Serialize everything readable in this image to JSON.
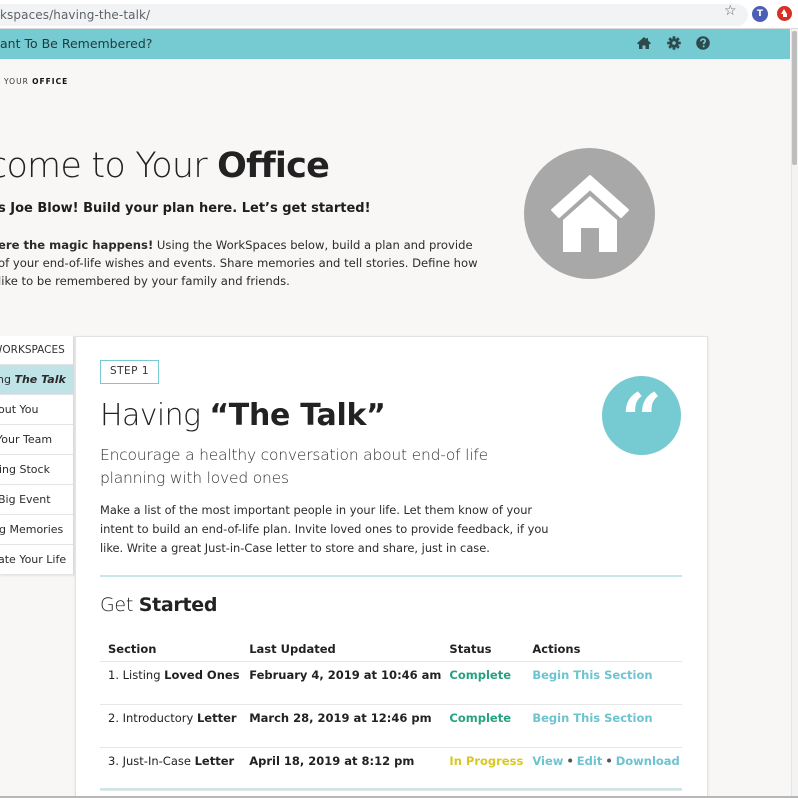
{
  "browser": {
    "url": "kspaces/having-the-talk/",
    "profile_initial": "T"
  },
  "appbar": {
    "title": "ant To Be Remembered?",
    "icons": [
      "home-icon",
      "gear-icon",
      "help-icon"
    ]
  },
  "breadcrumb": {
    "prefix": "YOUR",
    "current": "OFFICE"
  },
  "welcome": {
    "title_light": "come to Your ",
    "title_bold": "Office",
    "subtitle": "s Joe Blow! Build your plan here. Let’s get started!",
    "body_bold": "ere the magic happens!",
    "body_lines": [
      " Using the WorkSpaces below, build a plan and provide",
      " of your end-of-life wishes and events. Share memories and tell stories. Define how",
      "like to be remembered by your family and friends."
    ]
  },
  "sidebar": {
    "header": "WORKSPACES",
    "items": [
      {
        "prefix": "ng ",
        "italic": "The Talk",
        "active": true
      },
      {
        "label": "out You",
        "active": false
      },
      {
        "label": " Your Team",
        "active": false
      },
      {
        "label": "ing Stock",
        "active": false
      },
      {
        "label": " Big Event",
        "active": false
      },
      {
        "label": "g Memories",
        "active": false
      },
      {
        "label": "ate Your Life",
        "active": false
      }
    ]
  },
  "step": {
    "badge": "STEP 1",
    "title_light": "Having ",
    "title_bold": "“The Talk”",
    "subtitle": "Encourage a healthy conversation about end-of life planning with loved ones",
    "description_lines": [
      "Make a list of the most important people in your life. Let them know of your",
      "intent to build an end-of-life plan. Invite loved ones to provide feedback, if you",
      "like. Write a great Just-in-Case letter to store and share, just in case."
    ],
    "quote_glyph": "“"
  },
  "get_started": {
    "title_light": "Get ",
    "title_bold": "Started",
    "columns": [
      "Section",
      "Last Updated",
      "Status",
      "Actions"
    ],
    "rows": [
      {
        "section_prefix": "1. Listing ",
        "section_bold": "Loved Ones",
        "updated": "February 4, 2019 at 10:46 am",
        "status": "Complete",
        "status_type": "complete",
        "actions": [
          "Begin This Section"
        ]
      },
      {
        "section_prefix": "2. Introductory ",
        "section_bold": "Letter",
        "updated": "March 28, 2019 at 12:46 pm",
        "status": "Complete",
        "status_type": "complete",
        "actions": [
          "Begin This Section"
        ]
      },
      {
        "section_prefix": "3. Just-In-Case ",
        "section_bold": "Letter",
        "updated": "April 18, 2019 at 8:12 pm",
        "status": "In Progress",
        "status_type": "progress",
        "actions": [
          "View",
          "Edit",
          "Download"
        ]
      }
    ],
    "action_separator": "•"
  },
  "colors": {
    "accent_teal": "#76cad1",
    "sidebar_active": "#bfe3e6",
    "status_complete": "#27a17f",
    "status_in_progress": "#d8c820",
    "action_link": "#6cc4d0",
    "badge_gray": "#a8a8a8"
  }
}
